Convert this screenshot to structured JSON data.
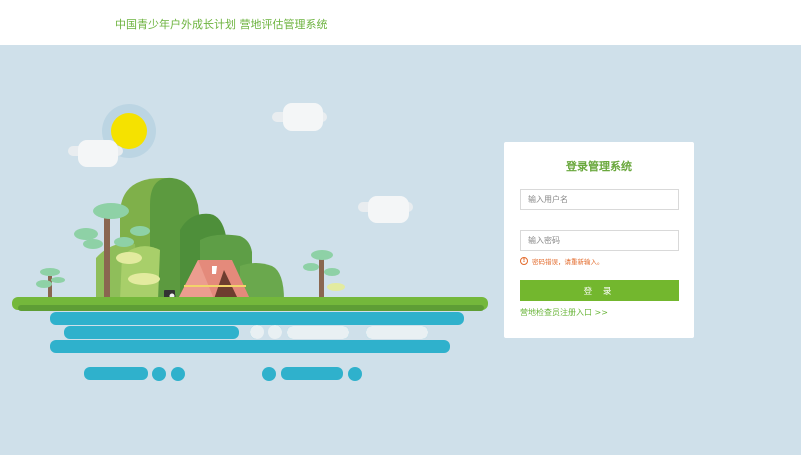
{
  "header": {
    "title": "中国青少年户外成长计划 营地评估管理系统"
  },
  "colors": {
    "brand_green": "#6cb33e",
    "button_green": "#73b72e",
    "error_orange": "#e36b2c",
    "sky_background": "#cfe0ea"
  },
  "login": {
    "title": "登录管理系统",
    "username_placeholder": "输入用户名",
    "password_placeholder": "输入密码",
    "error_message": "密码错误，请重新输入。",
    "login_button_label": "登 录",
    "register_link": "营地检查员注册入口 >>"
  },
  "illustration": {
    "icons": [
      "sun-icon",
      "cloud-icon",
      "tree-icon",
      "mountain-icon",
      "tent-icon",
      "camera-icon",
      "island-icon",
      "water-reflection-icon"
    ]
  }
}
